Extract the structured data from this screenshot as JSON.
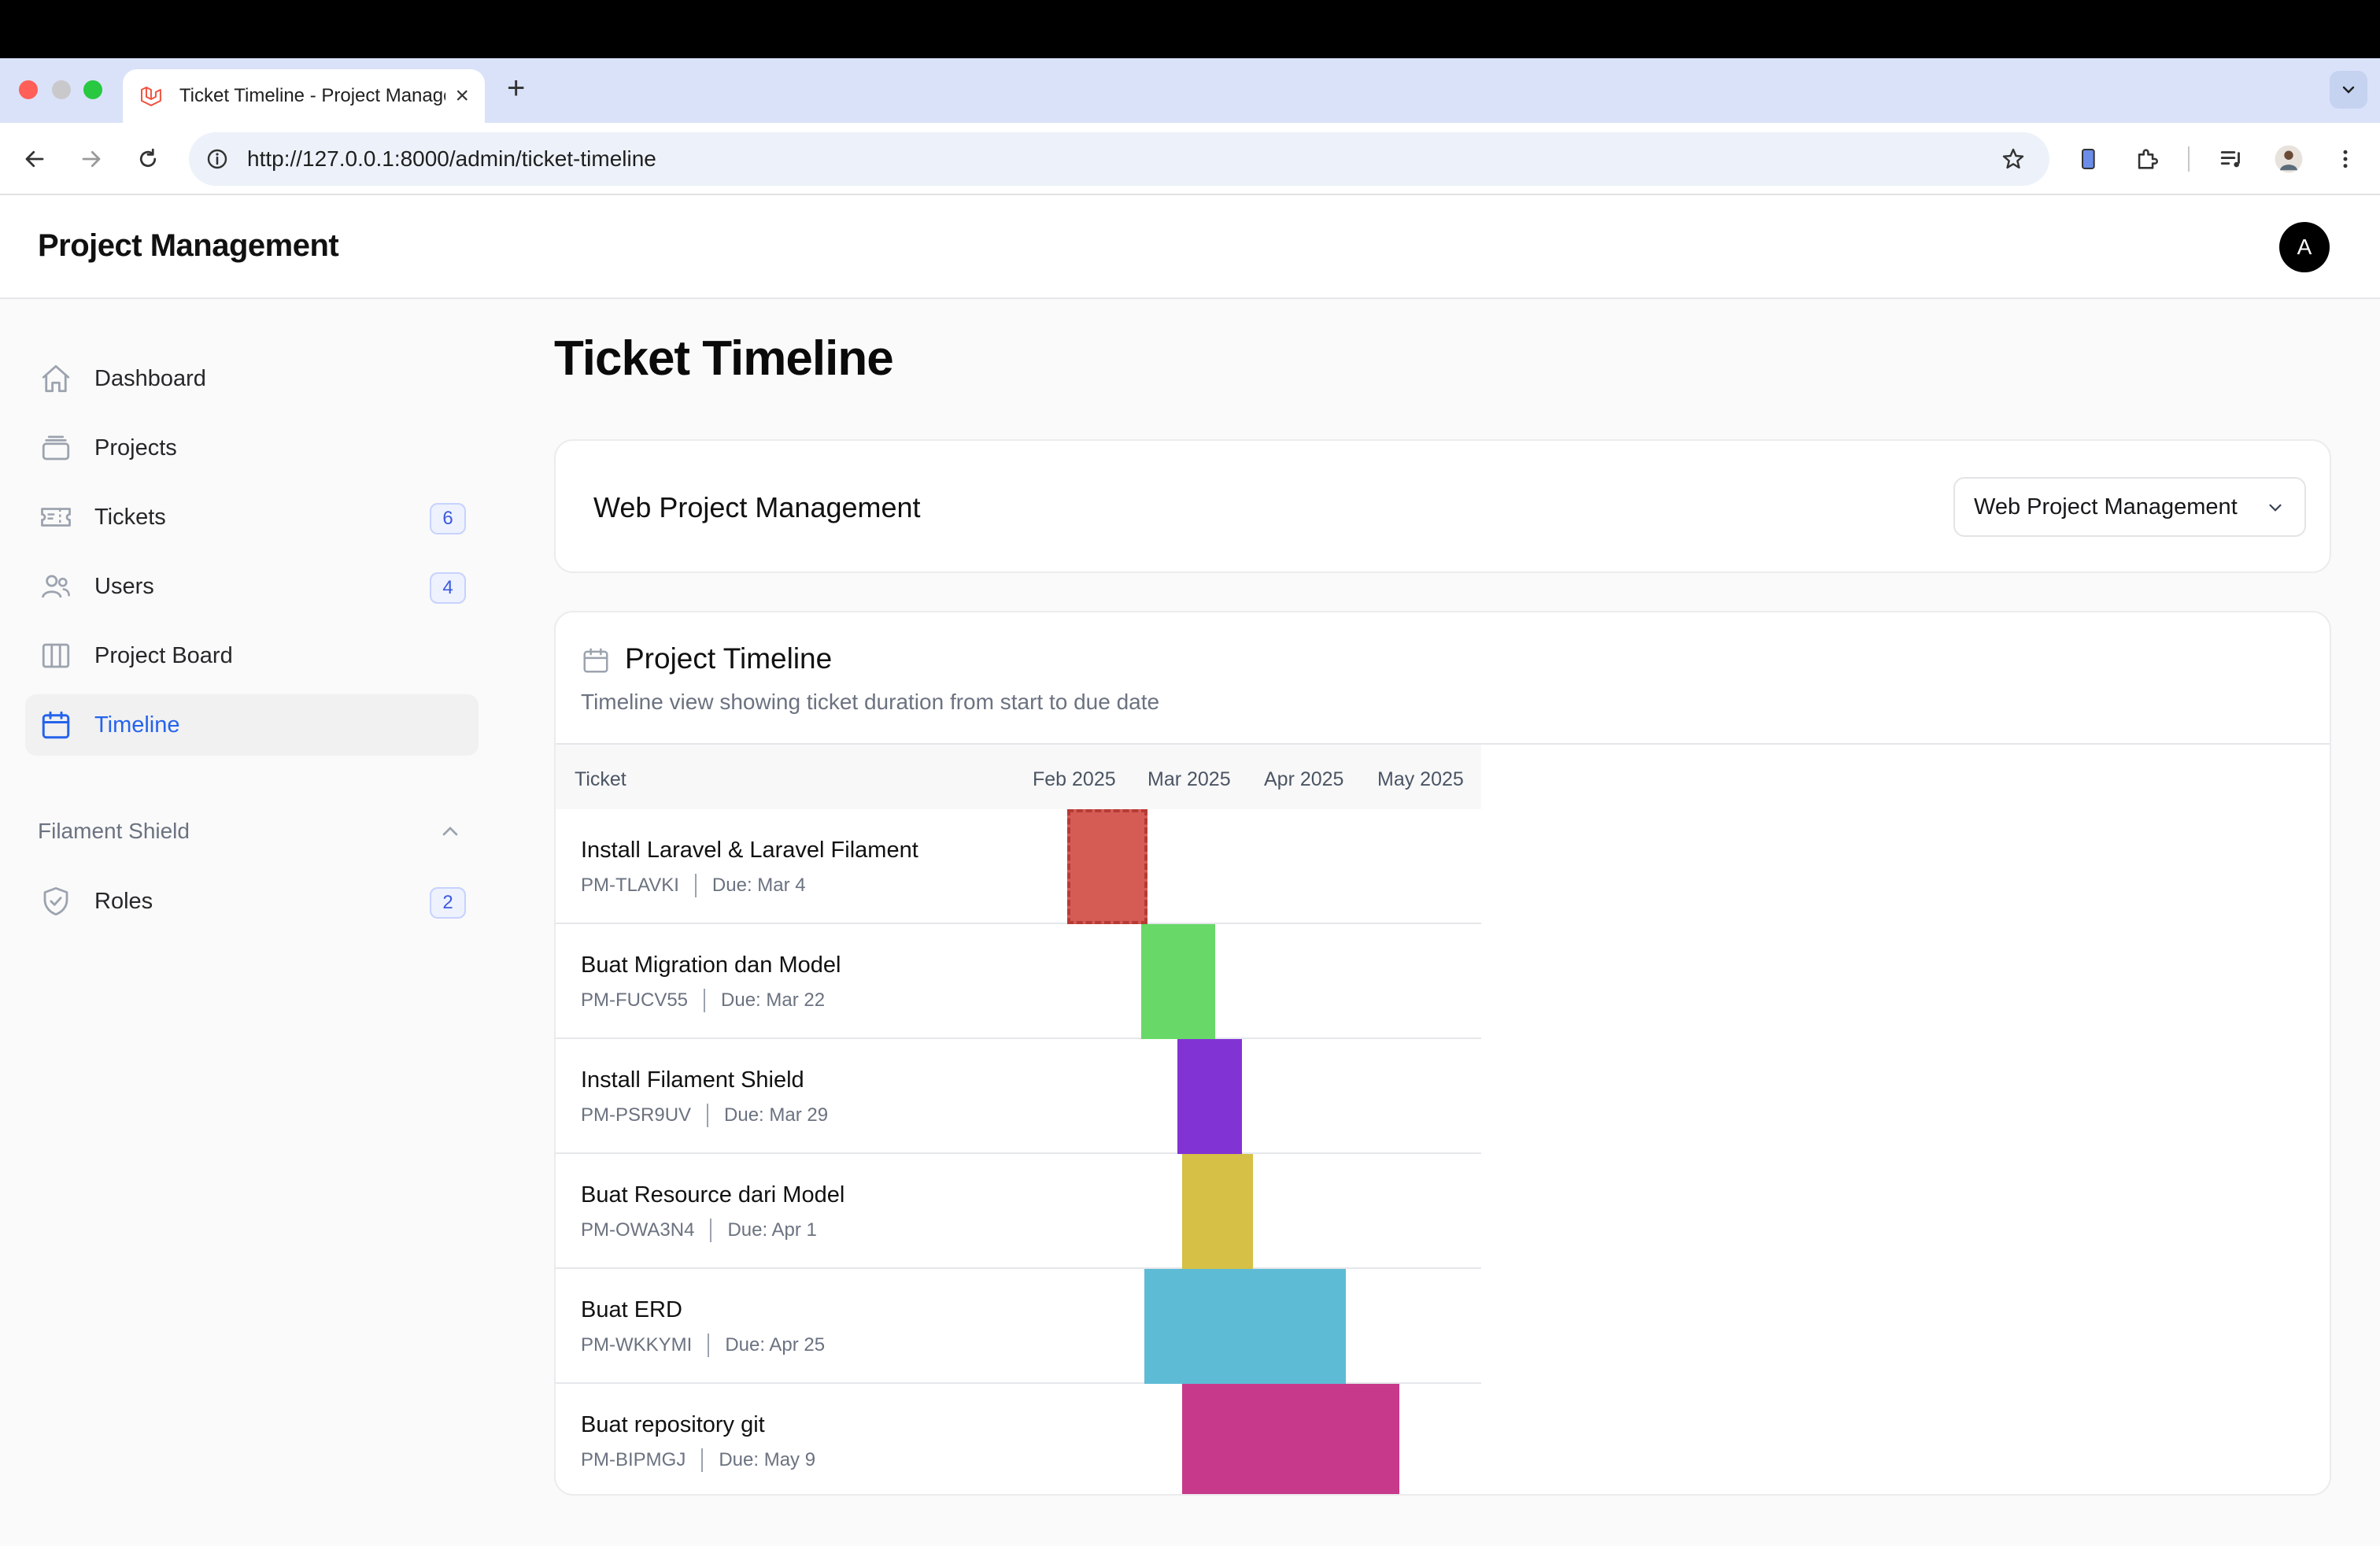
{
  "browser": {
    "tab_title": "Ticket Timeline - Project Management",
    "url": "http://127.0.0.1:8000/admin/ticket-timeline"
  },
  "app": {
    "brand": "Project Management",
    "avatar_initial": "A"
  },
  "sidebar": {
    "items": [
      {
        "label": "Dashboard",
        "icon": "home-icon"
      },
      {
        "label": "Projects",
        "icon": "folder-stack-icon"
      },
      {
        "label": "Tickets",
        "icon": "ticket-icon",
        "badge": "6"
      },
      {
        "label": "Users",
        "icon": "users-icon",
        "badge": "4"
      },
      {
        "label": "Project Board",
        "icon": "columns-icon"
      },
      {
        "label": "Timeline",
        "icon": "calendar-icon",
        "active": true
      }
    ],
    "group": {
      "label": "Filament Shield",
      "items": [
        {
          "label": "Roles",
          "icon": "shield-check-icon",
          "badge": "2"
        }
      ]
    }
  },
  "page": {
    "title": "Ticket Timeline"
  },
  "project_card": {
    "title": "Web Project Management",
    "select_value": "Web Project Management"
  },
  "timeline": {
    "title": "Project Timeline",
    "subtitle": "Timeline view showing ticket duration from start to due date",
    "column_header": "Ticket",
    "months": [
      "Feb 2025",
      "Mar 2025",
      "Apr 2025",
      "May 2025"
    ],
    "tickets": [
      {
        "name": "Install Laravel & Laravel Filament",
        "code": "PM-TLAVKI",
        "due": "Due: Mar 4",
        "color": "#d45c55",
        "selected": true
      },
      {
        "name": "Buat Migration dan Model",
        "code": "PM-FUCV55",
        "due": "Due: Mar 22",
        "color": "#68d868"
      },
      {
        "name": "Install Filament Shield",
        "code": "PM-PSR9UV",
        "due": "Due: Mar 29",
        "color": "#8233d4"
      },
      {
        "name": "Buat Resource dari Model",
        "code": "PM-OWA3N4",
        "due": "Due: Apr 1",
        "color": "#d6c045"
      },
      {
        "name": "Buat ERD",
        "code": "PM-WKKYMI",
        "due": "Due: Apr 25",
        "color": "#5ebbd5"
      },
      {
        "name": "Buat repository git",
        "code": "PM-BIPMGJ",
        "due": "Due: May 9",
        "color": "#c73a8b"
      }
    ]
  }
}
